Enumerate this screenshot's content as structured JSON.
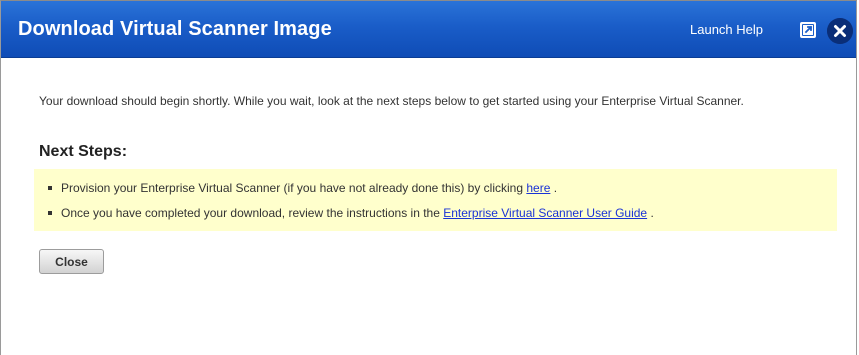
{
  "dialog": {
    "title": "Download Virtual Scanner Image",
    "launch_help": "Launch Help"
  },
  "content": {
    "intro": "Your download should begin shortly. While you wait, look at the next steps below to get started using your Enterprise Virtual Scanner.",
    "next_steps_heading": "Next Steps:",
    "steps": [
      {
        "text_before": "Provision your Enterprise Virtual Scanner (if you have not already done this) by clicking ",
        "link": "here",
        "text_after": " ."
      },
      {
        "text_before": "Once you have completed your download, review the instructions in the ",
        "link": "Enterprise Virtual Scanner User Guide",
        "text_after": " ."
      }
    ]
  },
  "buttons": {
    "close_label": "Close"
  },
  "colors": {
    "titlebar": "#1a5dc8",
    "steps_background": "#ffffcc",
    "link": "#1a33d6"
  }
}
